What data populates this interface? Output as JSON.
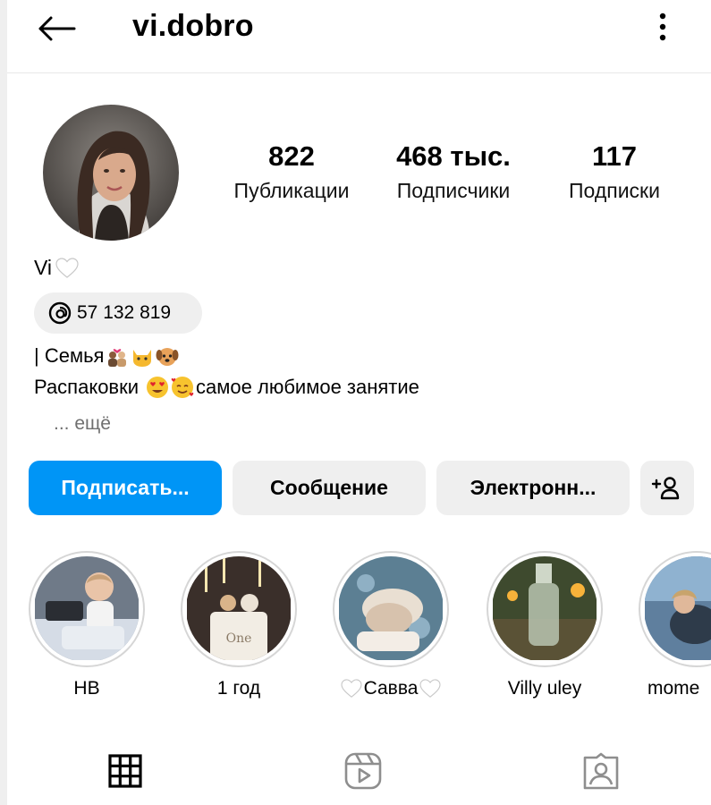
{
  "header": {
    "username": "vi.dobro",
    "back_icon": "arrow-left-icon",
    "more_icon": "more-vertical-icon"
  },
  "profile": {
    "avatar_icon": "profile-avatar",
    "stats": [
      {
        "value": "822",
        "label": "Публикации"
      },
      {
        "value": "468 тыс.",
        "label": "Подписчики"
      },
      {
        "value": "117",
        "label": "Подписки"
      }
    ],
    "name": "Vi",
    "threads_count": "57 132 819",
    "bio_line1": "| Семья",
    "bio_line2_start": "Распаковки",
    "bio_line2_end": "самое любимое занятие",
    "more_label": "... ещё"
  },
  "actions": {
    "follow": "Подписать...",
    "message": "Сообщение",
    "email": "Электронн...",
    "add_user_icon": "add-person-icon",
    "accent": "#0095f6"
  },
  "highlights": [
    {
      "label": "НВ"
    },
    {
      "label": "1 год"
    },
    {
      "label": "Савва"
    },
    {
      "label": "Villy uley"
    },
    {
      "label": "mome"
    }
  ],
  "tabs": [
    {
      "icon": "grid-icon"
    },
    {
      "icon": "reels-icon"
    },
    {
      "icon": "tagged-icon"
    }
  ]
}
